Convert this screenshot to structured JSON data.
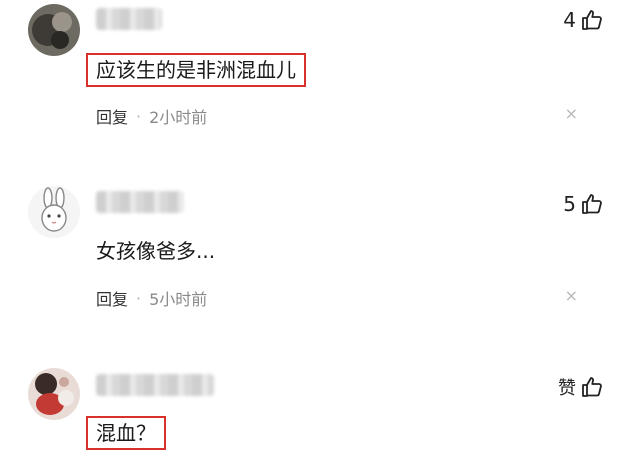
{
  "comments": [
    {
      "like_count": "4",
      "text": "应该生的是非洲混血儿",
      "reply_label": "回复",
      "separator": "·",
      "time": "2小时前",
      "close_glyph": "×"
    },
    {
      "like_count": "5",
      "text": "女孩像爸多...",
      "reply_label": "回复",
      "separator": "·",
      "time": "5小时前",
      "close_glyph": "×"
    },
    {
      "like_count": "赞",
      "text": "混血？"
    }
  ],
  "icons": {
    "like": "thumbs-up-icon",
    "close": "close-icon"
  },
  "colors": {
    "highlight_box": "#d9312a",
    "meta_text": "#8a8a8a"
  }
}
